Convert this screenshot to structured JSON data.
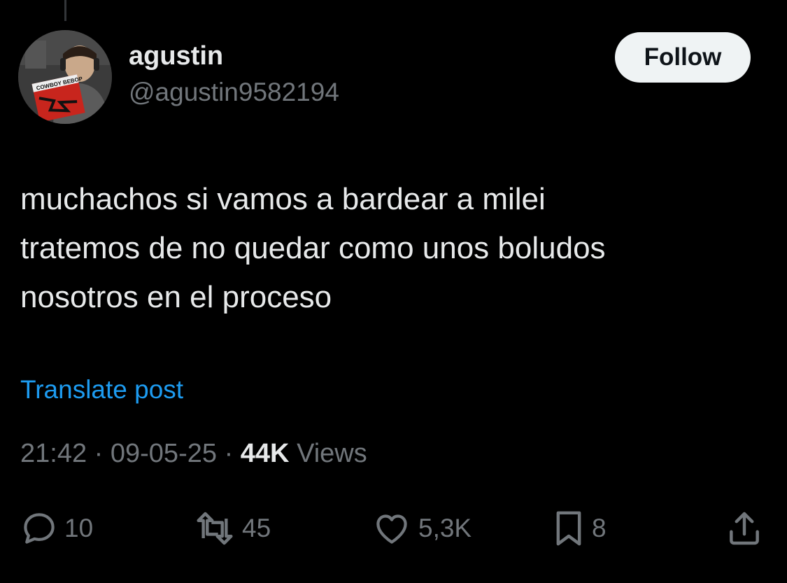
{
  "author": {
    "display_name": "agustin",
    "handle": "@agustin9582194",
    "avatar_icon": "profile-photo",
    "avatar_text": "COWBOY BEBOP"
  },
  "follow_label": "Follow",
  "post": {
    "text": "muchachos si vamos a bardear a milei\ntratemos de no quedar como unos boludos\nnosotros en el proceso",
    "translate_label": "Translate post",
    "time": "21:42",
    "separator": "·",
    "date": "09-05-25",
    "views_count": "44K",
    "views_label": "Views"
  },
  "actions": {
    "reply": {
      "icon": "reply-icon",
      "count": "10"
    },
    "repost": {
      "icon": "repost-icon",
      "count": "45"
    },
    "like": {
      "icon": "heart-icon",
      "count": "5,3K"
    },
    "bookmark": {
      "icon": "bookmark-icon",
      "count": "8"
    },
    "share": {
      "icon": "share-icon"
    }
  },
  "colors": {
    "background": "#000000",
    "text": "#e7e9ea",
    "secondary": "#71767b",
    "link": "#1d9bf0",
    "button_bg": "#eff3f4",
    "button_text": "#0f1419"
  }
}
